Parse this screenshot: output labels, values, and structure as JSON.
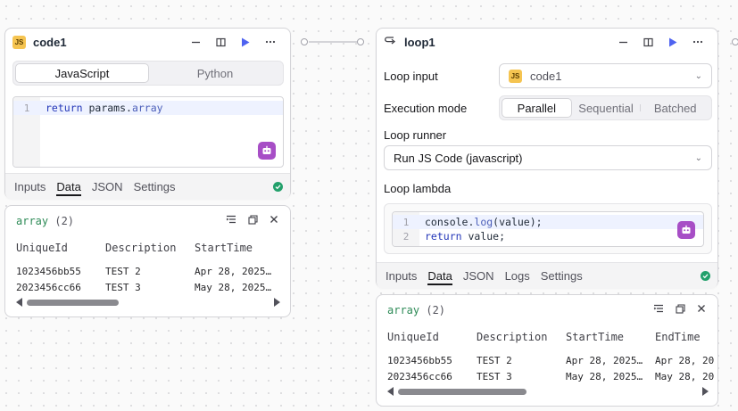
{
  "code_node": {
    "title": "code1",
    "badge": "JS",
    "languages": [
      "JavaScript",
      "Python"
    ],
    "active_language": "JavaScript",
    "code_lines": [
      {
        "num": "1",
        "parts": [
          {
            "t": "return",
            "c": "kw"
          },
          {
            "t": " params.",
            "c": ""
          },
          {
            "t": "array",
            "c": "fn"
          }
        ]
      }
    ],
    "tabs": [
      "Inputs",
      "Data",
      "JSON",
      "Settings"
    ],
    "active_tab": "Data"
  },
  "code_output": {
    "name": "array",
    "count": "(2)",
    "columns": [
      "UniqueId",
      "Description",
      "StartTime"
    ],
    "rows": [
      [
        "1023456bb55",
        "TEST 2",
        "Apr 28, 2025…"
      ],
      [
        "2023456cc66",
        "TEST 3",
        "May 28, 2025…"
      ]
    ],
    "scroll_fraction": 0.38
  },
  "loop_node": {
    "title": "loop1",
    "loop_input_label": "Loop input",
    "loop_input_badge": "JS",
    "loop_input_value": "code1",
    "execution_mode_label": "Execution mode",
    "modes": [
      "Parallel",
      "Sequential",
      "Batched"
    ],
    "active_mode": "Parallel",
    "loop_runner_label": "Loop runner",
    "loop_runner_value": "Run JS Code (javascript)",
    "loop_lambda_label": "Loop lambda",
    "code_lines": [
      {
        "num": "1",
        "parts": [
          {
            "t": "console.",
            "c": ""
          },
          {
            "t": "log",
            "c": "fn"
          },
          {
            "t": "(value);",
            "c": ""
          }
        ]
      },
      {
        "num": "2",
        "parts": [
          {
            "t": "return",
            "c": "kw"
          },
          {
            "t": " value;",
            "c": ""
          }
        ]
      }
    ],
    "tabs": [
      "Inputs",
      "Data",
      "JSON",
      "Logs",
      "Settings"
    ],
    "active_tab": "Data"
  },
  "loop_output": {
    "name": "array",
    "count": "(2)",
    "columns": [
      "UniqueId",
      "Description",
      "StartTime",
      "EndTime"
    ],
    "rows": [
      [
        "1023456bb55",
        "TEST 2",
        "Apr 28, 2025…",
        "Apr 28, 20"
      ],
      [
        "2023456cc66",
        "TEST 3",
        "May 28, 2025…",
        "May 28, 20"
      ]
    ],
    "scroll_fraction": 0.43
  },
  "colors": {
    "accent_play": "#4f63f0",
    "js_badge": "#f5c451",
    "ai_button": "#a74ec6",
    "status_ok": "#22a06b",
    "array_name": "#2e8b57"
  }
}
